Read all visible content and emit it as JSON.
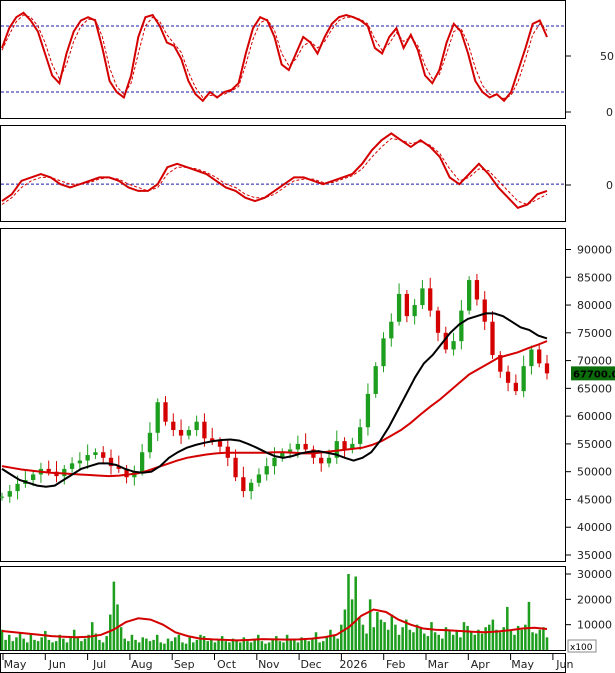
{
  "chart_data": [
    {
      "type": "line",
      "panel": "stochastic",
      "ylim": [
        0,
        100
      ],
      "y_ticks": [
        "50",
        "0"
      ],
      "reference_lines": [
        80,
        20
      ],
      "series": [
        {
          "color": "#d40000",
          "style": "solid",
          "values": [
            60,
            78,
            88,
            92,
            85,
            75,
            55,
            35,
            28,
            55,
            75,
            85,
            88,
            85,
            60,
            30,
            20,
            15,
            35,
            70,
            88,
            90,
            80,
            65,
            62,
            50,
            30,
            18,
            12,
            20,
            15,
            20,
            22,
            28,
            55,
            78,
            88,
            85,
            70,
            45,
            40,
            55,
            70,
            65,
            55,
            70,
            82,
            88,
            90,
            88,
            85,
            80,
            60,
            55,
            70,
            78,
            60,
            72,
            58,
            35,
            28,
            40,
            65,
            82,
            75,
            55,
            30,
            20,
            15,
            18,
            12,
            20,
            40,
            60,
            82,
            85,
            70
          ]
        },
        {
          "color": "#d40000",
          "style": "dashed",
          "values": [
            58,
            72,
            84,
            90,
            88,
            80,
            65,
            45,
            32,
            45,
            66,
            80,
            86,
            86,
            70,
            42,
            25,
            18,
            28,
            55,
            80,
            88,
            84,
            72,
            64,
            56,
            38,
            24,
            15,
            17,
            16,
            18,
            21,
            25,
            45,
            68,
            83,
            86,
            76,
            55,
            44,
            50,
            62,
            66,
            60,
            66,
            77,
            85,
            88,
            88,
            86,
            82,
            68,
            58,
            64,
            74,
            66,
            70,
            62,
            44,
            32,
            36,
            55,
            75,
            78,
            64,
            42,
            26,
            18,
            17,
            14,
            17,
            30,
            50,
            72,
            82,
            76
          ]
        }
      ]
    },
    {
      "type": "line",
      "panel": "oscillator",
      "ylim": [
        -1,
        1.6
      ],
      "y_ticks": [
        "0"
      ],
      "reference_lines": [
        0
      ],
      "series": [
        {
          "color": "#d40000",
          "style": "solid",
          "values": [
            -0.5,
            -0.3,
            0.1,
            0.2,
            0.3,
            0.2,
            0.0,
            -0.1,
            0.0,
            0.1,
            0.2,
            0.2,
            0.1,
            -0.1,
            -0.2,
            -0.2,
            0.0,
            0.5,
            0.6,
            0.5,
            0.4,
            0.3,
            0.1,
            -0.1,
            -0.2,
            -0.4,
            -0.5,
            -0.4,
            -0.2,
            0.0,
            0.2,
            0.2,
            0.1,
            0.0,
            0.1,
            0.2,
            0.3,
            0.6,
            1.0,
            1.3,
            1.5,
            1.3,
            1.1,
            1.3,
            1.1,
            0.8,
            0.2,
            0.0,
            0.3,
            0.6,
            0.3,
            -0.1,
            -0.4,
            -0.7,
            -0.6,
            -0.3,
            -0.2
          ]
        },
        {
          "color": "#d40000",
          "style": "dashed",
          "values": [
            -0.6,
            -0.4,
            -0.1,
            0.1,
            0.2,
            0.2,
            0.1,
            0.0,
            0.0,
            0.05,
            0.15,
            0.2,
            0.15,
            0.0,
            -0.1,
            -0.2,
            -0.1,
            0.3,
            0.5,
            0.5,
            0.45,
            0.35,
            0.2,
            0.0,
            -0.1,
            -0.3,
            -0.4,
            -0.4,
            -0.3,
            -0.1,
            0.1,
            0.15,
            0.15,
            0.05,
            0.05,
            0.15,
            0.25,
            0.45,
            0.8,
            1.1,
            1.35,
            1.3,
            1.2,
            1.25,
            1.15,
            0.9,
            0.45,
            0.1,
            0.2,
            0.45,
            0.4,
            0.1,
            -0.2,
            -0.5,
            -0.6,
            -0.45,
            -0.3
          ]
        }
      ]
    },
    {
      "type": "candlestick",
      "panel": "price",
      "ylim": [
        33000,
        93000
      ],
      "y_ticks": [
        "90000",
        "85000",
        "80000",
        "75000",
        "70000",
        "65000",
        "60000",
        "55000",
        "50000",
        "45000",
        "40000",
        "35000"
      ],
      "last_price_label": "67700.00",
      "up_color": "#1e9e1e",
      "down_color": "#d40000",
      "close": [
        45500,
        46500,
        47800,
        48500,
        49500,
        50500,
        50000,
        49200,
        50500,
        51500,
        52000,
        53000,
        53500,
        52500,
        51000,
        50500,
        49000,
        50000,
        53500,
        57000,
        62500,
        59000,
        57500,
        56500,
        57500,
        59000,
        56000,
        55500,
        54500,
        52500,
        49000,
        46500,
        48000,
        49500,
        51000,
        52500,
        53500,
        54000,
        55000,
        54000,
        52500,
        51500,
        52500,
        55500,
        54000,
        55000,
        58000,
        64000,
        69000,
        74000,
        77000,
        82000,
        78000,
        80000,
        83000,
        79000,
        75000,
        72000,
        73500,
        79000,
        84500,
        81000,
        77000,
        71000,
        68000,
        66000,
        64500,
        69000,
        72000,
        69500,
        67700
      ],
      "series": [
        {
          "name": "",
          "color": "#000000",
          "values": [
            50500,
            49500,
            48500,
            48000,
            47500,
            47300,
            47500,
            48500,
            49500,
            50500,
            51000,
            51500,
            51500,
            51200,
            50500,
            50000,
            49800,
            50000,
            51000,
            52500,
            53500,
            54300,
            54800,
            55200,
            55500,
            55700,
            55800,
            55600,
            55000,
            54300,
            53500,
            52800,
            52500,
            52800,
            53300,
            53600,
            53700,
            53400,
            53100,
            52500,
            52000,
            52500,
            53500,
            55500,
            58000,
            61000,
            64000,
            67000,
            69500,
            71000,
            73000,
            75000,
            76500,
            77500,
            78000,
            78500,
            78500,
            78000,
            77000,
            76000,
            75500,
            74500,
            74000
          ]
        },
        {
          "name": "",
          "color": "#d40000",
          "values": [
            51000,
            50700,
            50400,
            50200,
            50000,
            49800,
            49700,
            49600,
            49500,
            49400,
            49300,
            49200,
            49300,
            49500,
            49700,
            50200,
            50800,
            51400,
            52000,
            52500,
            52800,
            53100,
            53300,
            53400,
            53400,
            53400,
            53400,
            53400,
            53500,
            53500,
            53400,
            53300,
            53300,
            53500,
            53700,
            53900,
            54100,
            54300,
            54800,
            55500,
            56500,
            57500,
            58800,
            60300,
            61700,
            63000,
            64500,
            66000,
            67500,
            68500,
            69500,
            70500,
            71000,
            71500,
            72200,
            72800,
            73500
          ]
        }
      ]
    },
    {
      "type": "bar",
      "panel": "volume",
      "ylim": [
        0,
        31000
      ],
      "y_ticks": [
        "30000",
        "20000",
        "10000"
      ],
      "unit_label": "x100",
      "bar_color": "#1e9e1e",
      "values": [
        8000,
        4000,
        6000,
        3500,
        5000,
        7000,
        4500,
        3000,
        6500,
        4000,
        3500,
        5000,
        7500,
        4000,
        3000,
        3500,
        6000,
        4500,
        3000,
        5500,
        8000,
        5000,
        3500,
        4500,
        6000,
        11000,
        6500,
        4000,
        3000,
        5500,
        14000,
        27000,
        18000,
        9000,
        4500,
        3500,
        6000,
        4000,
        3000,
        5000,
        4500,
        3500,
        4000,
        6000,
        3000,
        2500,
        4500,
        3500,
        5000,
        6000,
        3000,
        2500,
        5000,
        3000,
        4000,
        6000,
        5500,
        3500,
        4500,
        3000,
        4000,
        5500,
        3500,
        3000,
        4500,
        4000,
        3000,
        5000,
        3500,
        3000,
        4000,
        6000,
        3500,
        2500,
        3000,
        4500,
        5500,
        3500,
        3000,
        6000,
        4500,
        4000,
        3000,
        5000,
        4000,
        3500,
        4500,
        7000,
        3000,
        3500,
        5000,
        8000,
        6000,
        4500,
        10000,
        16000,
        30000,
        20000,
        29000,
        13000,
        10000,
        6500,
        20000,
        9000,
        15000,
        12000,
        11000,
        8000,
        14000,
        10000,
        6000,
        9000,
        12000,
        8000,
        7000,
        10000,
        8500,
        6500,
        5500,
        11000,
        7000,
        6000,
        4500,
        9000,
        8000,
        6000,
        7500,
        5000,
        11000,
        9500,
        7000,
        6000,
        8000,
        6500,
        9000,
        10000,
        12000,
        8000,
        7000,
        9000,
        17000,
        7500,
        6000,
        9500,
        8000,
        10000,
        19000,
        7000,
        6500,
        8000,
        9000,
        5000
      ],
      "series": [
        {
          "name": "",
          "color": "#d40000",
          "values": [
            7500,
            7000,
            6500,
            6000,
            5500,
            5200,
            5000,
            5200,
            6000,
            8000,
            11000,
            12500,
            12000,
            10000,
            7000,
            5500,
            4500,
            4200,
            4000,
            3800,
            4000,
            4300,
            4200,
            4100,
            4200,
            4500,
            5000,
            6000,
            9000,
            13500,
            16000,
            15000,
            12000,
            10000,
            8500,
            8000,
            7800,
            7500,
            7200,
            7000,
            7300,
            7800,
            8500,
            8800,
            8300
          ]
        }
      ]
    }
  ],
  "x_axis": {
    "months": [
      "May",
      "Jun",
      "Jul",
      "Aug",
      "Sep",
      "Oct",
      "Nov",
      "Dec",
      "2026",
      "Feb",
      "Mar",
      "Apr",
      "May",
      "Jun"
    ]
  }
}
